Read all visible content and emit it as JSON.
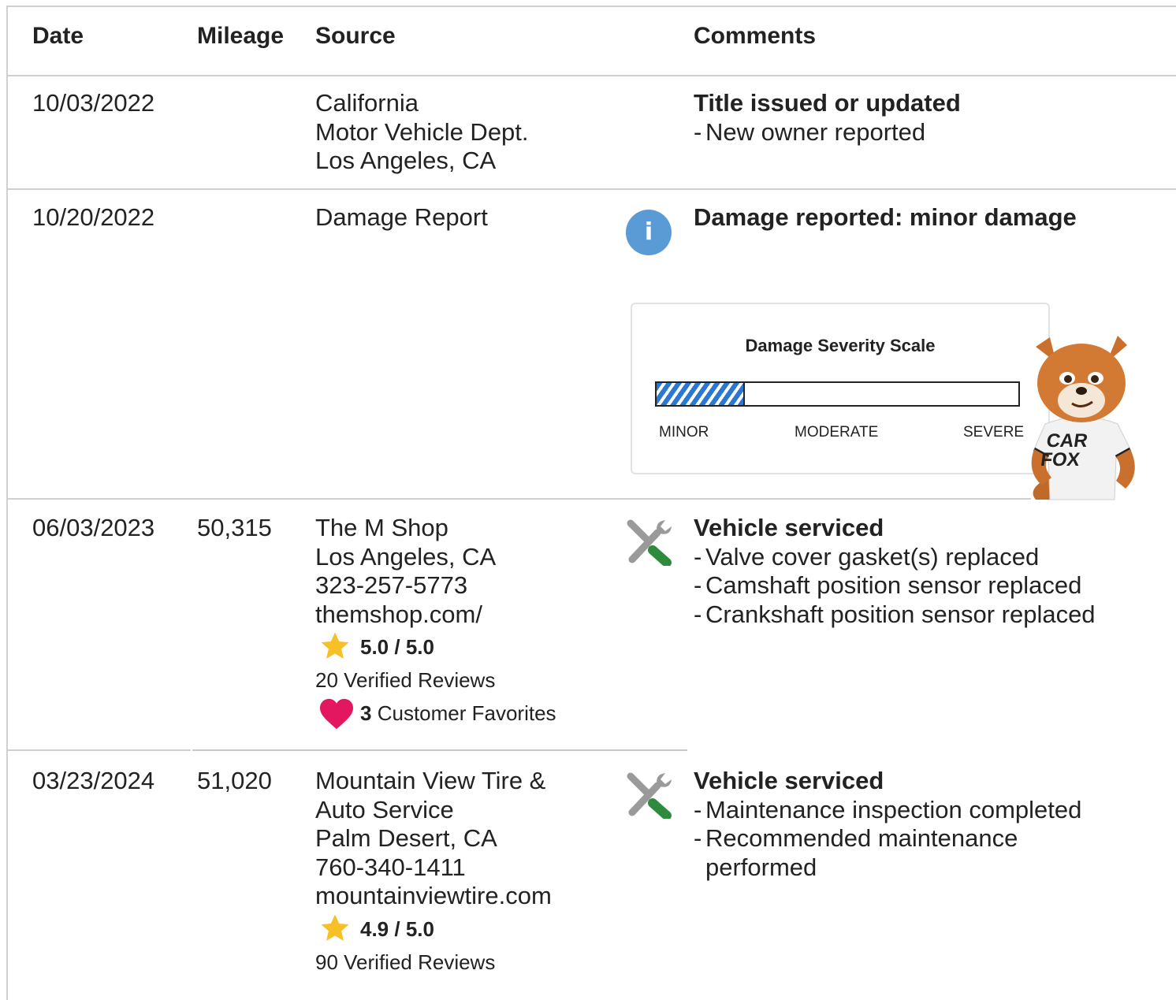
{
  "table": {
    "headers": {
      "date": "Date",
      "mileage": "Mileage",
      "source": "Source",
      "comments": "Comments"
    },
    "rows": [
      {
        "date": "10/03/2022",
        "mileage": "",
        "source": [
          "California",
          "Motor Vehicle Dept.",
          "Los Angeles, CA"
        ],
        "comment_title": "Title issued or updated",
        "comment_items": [
          "New owner reported"
        ]
      },
      {
        "date": "10/20/2022",
        "mileage": "",
        "source": [
          "Damage Report"
        ],
        "icon": "info-icon",
        "comment_title": "Damage reported: minor damage",
        "severity": {
          "title": "Damage Severity Scale",
          "level": "MINOR",
          "fill_fraction": 0.24,
          "labels": [
            "MINOR",
            "MODERATE",
            "SEVERE"
          ]
        },
        "mascot": "car-fox-mascot",
        "mascot_shirt": [
          "CAR",
          "FOX"
        ]
      },
      {
        "date": "06/03/2023",
        "mileage": "50,315",
        "source": [
          "The M Shop",
          "Los Angeles, CA",
          "323-257-5773",
          "themshop.com/"
        ],
        "rating": "5.0 / 5.0",
        "reviews": "20 Verified Reviews",
        "favorites_count": "3",
        "favorites_label": "Customer Favorites",
        "icon": "tools-icon",
        "comment_title": "Vehicle serviced",
        "comment_items": [
          "Valve cover gasket(s) replaced",
          "Camshaft position sensor replaced",
          "Crankshaft position sensor replaced"
        ]
      },
      {
        "date": "03/23/2024",
        "mileage": "51,020",
        "source": [
          "Mountain View Tire &",
          "Auto Service",
          "Palm Desert, CA",
          "760-340-1411",
          "mountainviewtire.com"
        ],
        "rating": "4.9 / 5.0",
        "reviews": "90 Verified Reviews",
        "icon": "tools-icon",
        "comment_title": "Vehicle serviced",
        "comment_items": [
          "Maintenance inspection completed",
          "Recommended maintenance",
          "performed"
        ]
      }
    ]
  },
  "colors": {
    "border": "#d0d0d0",
    "info": "#5b9bd5",
    "star": "#f6c026",
    "heart": "#e2175f",
    "wrench": "#9a9a9a",
    "screwdriver": "#2e8b3e",
    "severity_fill": "#2a78d3"
  }
}
